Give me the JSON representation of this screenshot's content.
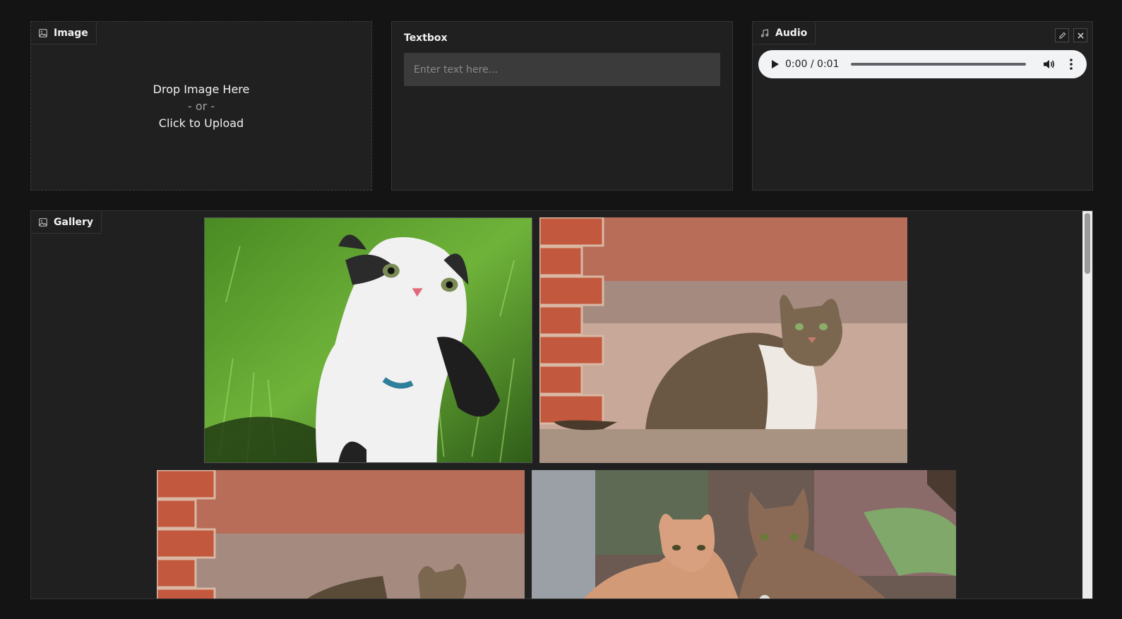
{
  "image_block": {
    "label": "Image",
    "icon": "image-icon",
    "drop_text": "Drop Image Here",
    "or_text": "- or -",
    "click_text": "Click to Upload"
  },
  "textbox_block": {
    "label": "Textbox",
    "value": "",
    "placeholder": "Enter text here..."
  },
  "audio_block": {
    "label": "Audio",
    "icon": "music-note-icon",
    "edit_icon": "pencil-icon",
    "close_icon": "close-icon",
    "time": "0:00 / 0:01",
    "progress": 0
  },
  "gallery_block": {
    "label": "Gallery",
    "icon": "image-icon",
    "items": [
      {
        "subject": "black-and-white cat in grass"
      },
      {
        "subject": "tabby cat by brick wall"
      },
      {
        "subject": "tabby cat by brick wall"
      },
      {
        "subject": "two kittens"
      }
    ]
  },
  "colors": {
    "background": "#141414",
    "panel": "#202020",
    "input": "#3b3b3b",
    "audio_player": "#f1f3f4"
  }
}
